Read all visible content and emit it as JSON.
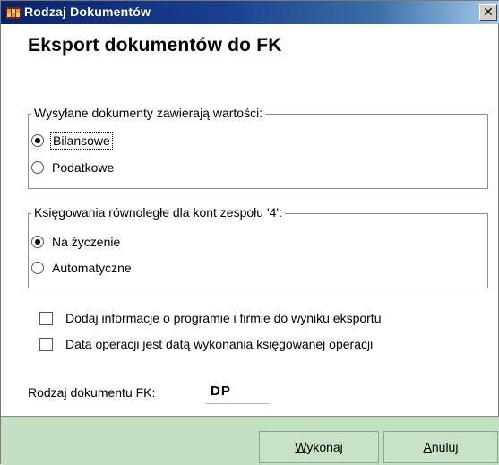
{
  "window": {
    "title": "Rodzaj Dokumentów",
    "close_glyph": "✕"
  },
  "heading": "Eksport dokumentów do FK",
  "group_values": {
    "legend": "Wysyłane dokumenty zawierają wartości:",
    "options": [
      {
        "label": "Bilansowe",
        "selected": true
      },
      {
        "label": "Podatkowe",
        "selected": false
      }
    ]
  },
  "group_parallel": {
    "legend": "Księgowania równoległe dla kont zespołu '4':",
    "options": [
      {
        "label": "Na życzenie",
        "selected": true
      },
      {
        "label": "Automatyczne",
        "selected": false
      }
    ]
  },
  "checkboxes": [
    {
      "label": "Dodaj informacje o programie i firmie do wyniku eksportu",
      "checked": false
    },
    {
      "label": "Data operacji jest datą wykonania księgowanej operacji",
      "checked": false
    }
  ],
  "fk": {
    "label": "Rodzaj dokumentu FK:",
    "value": "DP"
  },
  "buttons": {
    "execute": {
      "accel": "W",
      "rest": "ykonaj"
    },
    "cancel": {
      "accel": "A",
      "rest": "nuluj"
    }
  },
  "colors": {
    "title_gradient_start": "#0a246a",
    "footer_bg": "#c4e0c4"
  }
}
